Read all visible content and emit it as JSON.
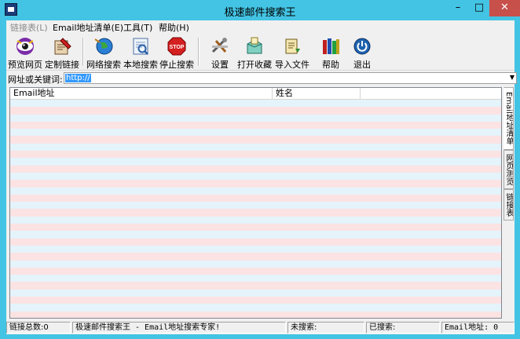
{
  "window": {
    "title": "极速邮件搜索王",
    "minimize": "–",
    "maximize": "□",
    "close": "✕"
  },
  "menu": [
    {
      "label": "链接表(L)",
      "enabled": false
    },
    {
      "label": "Email地址清单(E)",
      "enabled": true
    },
    {
      "label": "工具(T)",
      "enabled": true
    },
    {
      "label": "帮助(H)",
      "enabled": true
    }
  ],
  "toolbar": [
    {
      "label": "预览网页",
      "icon": "eye-icon"
    },
    {
      "label": "定制链接",
      "icon": "edit-link-icon"
    },
    {
      "label": "网络搜索",
      "icon": "globe-search-icon"
    },
    {
      "label": "本地搜索",
      "icon": "local-search-icon"
    },
    {
      "label": "停止搜索",
      "icon": "stop-icon"
    },
    {
      "label": "设置",
      "icon": "settings-tools-icon"
    },
    {
      "label": "打开收藏",
      "icon": "open-favorites-icon"
    },
    {
      "label": "导入文件",
      "icon": "import-file-icon"
    },
    {
      "label": "帮助",
      "icon": "help-books-icon"
    },
    {
      "label": "退出",
      "icon": "power-icon"
    }
  ],
  "address": {
    "label": "网址或关键词:",
    "value": "http://"
  },
  "list": {
    "columns": [
      "Email地址",
      "姓名",
      ""
    ]
  },
  "side_tabs": [
    "Email地址清单",
    "网页测览",
    "链接表"
  ],
  "status": {
    "link_count": "链接总数:0",
    "tagline": "极速邮件搜索王 - Email地址搜索专家!",
    "unsearched": "未搜索:",
    "searched": "已搜索:",
    "email_count": "Email地址: 0"
  },
  "colors": {
    "titlebar": "#43c4e4",
    "row_blue": "#e5f3fb",
    "row_pink": "#fbe3e3",
    "close_button": "#c7504b"
  }
}
